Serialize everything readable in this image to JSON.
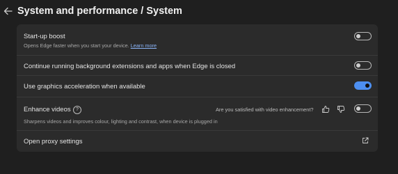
{
  "header": {
    "title": "System and performance / System",
    "back_icon": "arrow-left-icon"
  },
  "settings": {
    "startup_boost": {
      "label": "Start-up boost",
      "description": "Opens Edge faster when you start your device.",
      "link": "Learn more",
      "enabled": false
    },
    "background_extensions": {
      "label": "Continue running background extensions and apps when Edge is closed",
      "enabled": false
    },
    "graphics_acceleration": {
      "label": "Use graphics acceleration when available",
      "enabled": true
    },
    "enhance_videos": {
      "label": "Enhance videos",
      "help_icon": "?",
      "feedback_question": "Are you satisfied with video enhancement?",
      "description": "Sharpens videos and improves colour, lighting and contrast, when device is plugged in",
      "enabled": false
    },
    "proxy": {
      "label": "Open proxy settings",
      "icon": "external-link-icon"
    }
  },
  "colors": {
    "background": "#1f1f1f",
    "panel": "#2b2b2b",
    "accent": "#4d8ff0",
    "link": "#8ab4f8"
  }
}
